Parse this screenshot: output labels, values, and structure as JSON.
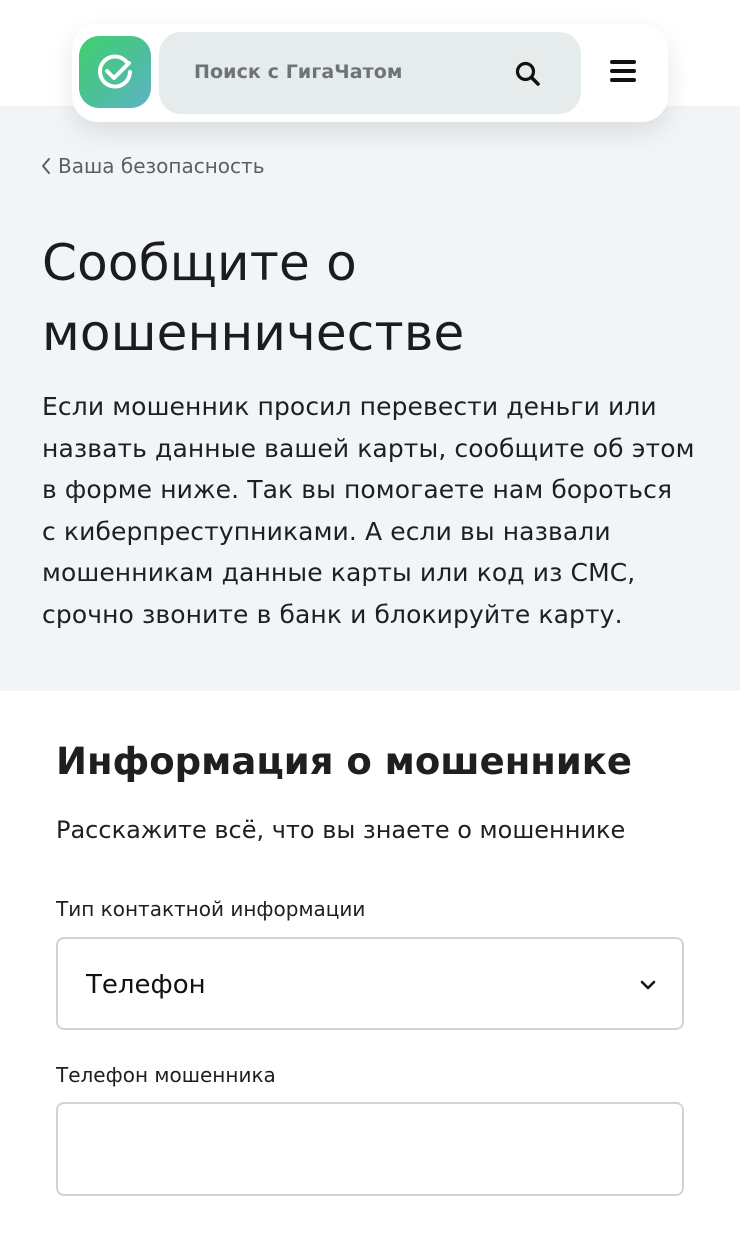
{
  "header": {
    "search_placeholder": "Поиск с ГигаЧатом"
  },
  "breadcrumb": {
    "label": "Ваша безопасность"
  },
  "hero": {
    "title_line1": "Сообщите о",
    "title_line2": "мошенничестве",
    "intro_lines": [
      "Если мошенник просил перевести деньги или",
      "назвать данные вашей карты, сообщите об этом",
      "в форме ниже. Так вы помогаете нам бороться",
      "с киберпреступниками. А если вы назвали",
      "мошенникам данные карты или код из СМС,",
      "срочно звоните в банк и блокируйте карту."
    ]
  },
  "form": {
    "section_title": "Информация о мошеннике",
    "section_subtitle": "Расскажите всё, что вы знаете о мошеннике",
    "contact_type_label": "Тип контактной информации",
    "contact_type_value": "Телефон",
    "phone_label": "Телефон мошенника",
    "phone_value": ""
  },
  "icons": {
    "logo": "sber-check-logo-icon",
    "search": "search-icon",
    "menu": "hamburger-menu-icon",
    "back": "chevron-left-icon",
    "dropdown": "chevron-down-icon"
  },
  "colors": {
    "hero_bg": "#f2f5f8",
    "search_bg": "#e6ebeb",
    "logo_gradient_start": "#3fd16f",
    "logo_gradient_end": "#5fb3c8",
    "field_border": "#d0d3d6"
  }
}
